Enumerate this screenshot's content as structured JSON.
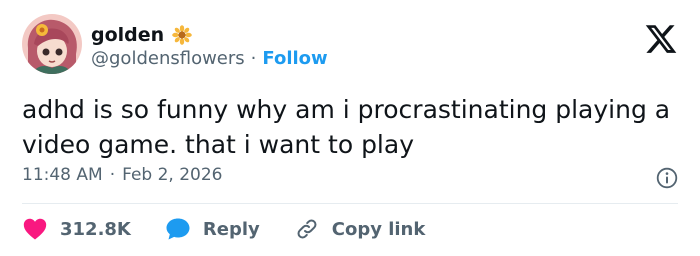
{
  "user": {
    "display_name": "golden",
    "handle": "@goldensflowers",
    "follow_label": "Follow",
    "badge_icon": "sunflower-icon"
  },
  "tweet": {
    "text": "adhd is so funny why am i procrastinating playing a video game. that i want to play",
    "time": "11:48 AM",
    "date": "Feb 2, 2026"
  },
  "actions": {
    "likes": "312.8K",
    "reply_label": "Reply",
    "copy_label": "Copy link"
  },
  "colors": {
    "accent": "#1d9bf0",
    "like": "#f91880",
    "muted": "#536471",
    "text": "#0f1419"
  }
}
